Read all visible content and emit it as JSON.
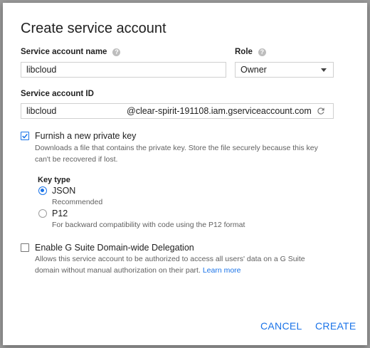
{
  "dialog": {
    "title": "Create service account"
  },
  "form": {
    "name_label": "Service account name",
    "name_value": "libcloud",
    "role_label": "Role",
    "role_value": "Owner",
    "id_label": "Service account ID",
    "id_value": "libcloud",
    "id_suffix": "@clear-spirit-191108.iam.gserviceaccount.com",
    "help_icon_glyph": "?"
  },
  "private_key": {
    "checkbox_label": "Furnish a new private key",
    "checked": true,
    "description_line1": "Downloads a file that contains the private key. Store the file securely because this key",
    "description_line2": "can't be recovered if lost.",
    "key_type_label": "Key type",
    "options": [
      {
        "label": "JSON",
        "hint": "Recommended",
        "selected": true
      },
      {
        "label": "P12",
        "hint": "For backward compatibility with code using the P12 format",
        "selected": false
      }
    ]
  },
  "delegation": {
    "checkbox_label": "Enable G Suite Domain-wide Delegation",
    "checked": false,
    "description_line1": "Allows this service account to be authorized to access all users' data on a G Suite",
    "description_line2": "domain without manual authorization on their part.",
    "learn_more": "Learn more"
  },
  "actions": {
    "cancel": "CANCEL",
    "create": "CREATE"
  },
  "colors": {
    "accent": "#1a73e8",
    "backdrop": "#9a9a9a"
  }
}
